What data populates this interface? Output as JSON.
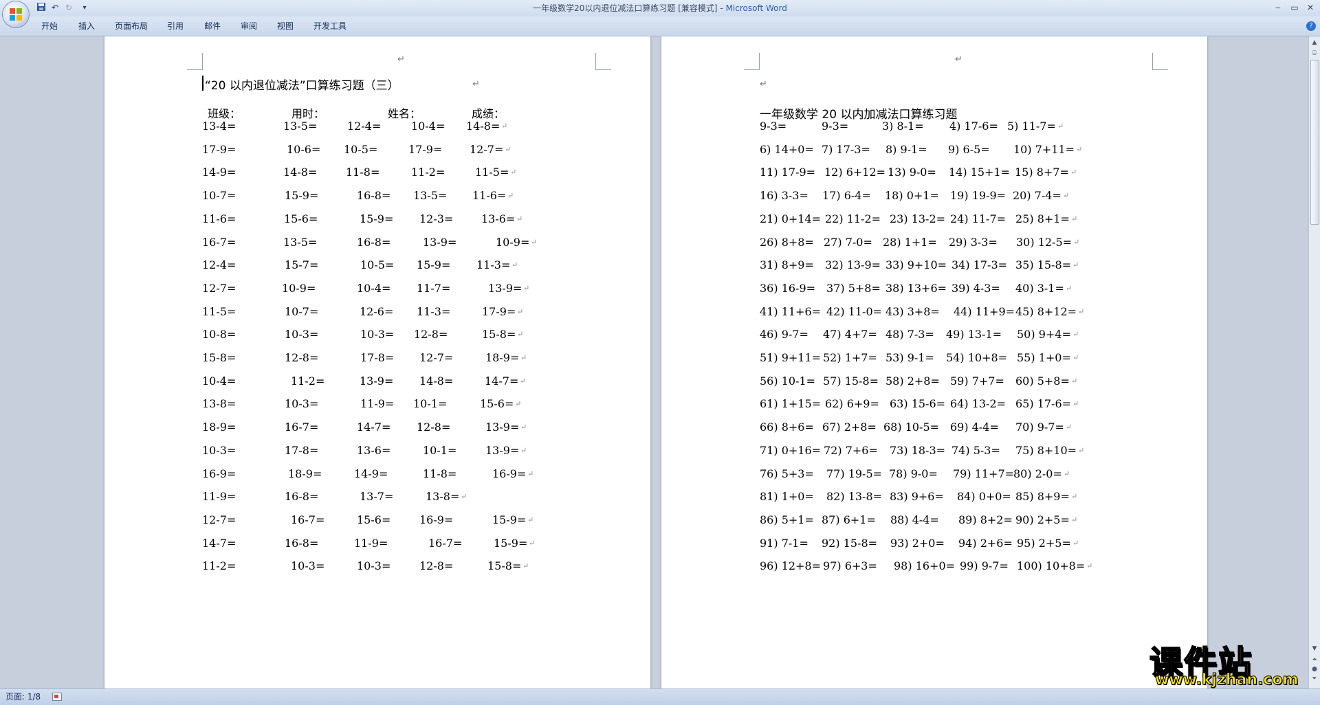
{
  "window": {
    "title": "一年级数学20以内退位减法口算练习题 [兼容模式] - ",
    "app_name": "Microsoft Word",
    "minimize_glyph": "‒",
    "maximize_glyph": "▭",
    "close_glyph": "✕"
  },
  "quick_access": {
    "save_icon": "save-icon",
    "undo_glyph": "↶",
    "redo_glyph": "↻",
    "customize_glyph": "▾"
  },
  "menu": [
    "开始",
    "插入",
    "页面布局",
    "引用",
    "邮件",
    "审阅",
    "视图",
    "开发工具"
  ],
  "help_glyph": "?",
  "pilcrow": "↵",
  "page_left": {
    "title": "“20 以内退位减法”口算练习题（三）",
    "header_labels": [
      "班级：",
      "用时：",
      "姓名：",
      "成绩："
    ],
    "rows": [
      [
        "13-4=",
        "13-5=",
        "12-4=",
        "10-4=",
        "14-8="
      ],
      [
        "17-9=",
        "10-6=",
        "10-5=",
        "17-9=",
        "12-7="
      ],
      [
        "14-9=",
        "14-8=",
        "11-8=",
        "11-2=",
        "11-5="
      ],
      [
        "10-7=",
        "15-9=",
        "16-8=",
        "13-5=",
        "11-6="
      ],
      [
        "11-6=",
        "15-6=",
        "15-9=",
        "12-3=",
        "13-6="
      ],
      [
        "16-7=",
        "13-5=",
        "16-8=",
        "13-9=",
        "10-9="
      ],
      [
        "12-4=",
        "15-7=",
        "10-5=",
        "15-9=",
        "11-3="
      ],
      [
        "12-7=",
        "10-9=",
        "10-4=",
        "11-7=",
        "13-9="
      ],
      [
        "11-5=",
        "10-7=",
        "12-6=",
        "11-3=",
        "17-9="
      ],
      [
        "10-8=",
        "10-3=",
        "10-3=",
        "12-8=",
        "15-8="
      ],
      [
        "15-8=",
        "12-8=",
        "17-8=",
        "12-7=",
        "18-9="
      ],
      [
        "10-4=",
        "11-2=",
        "13-9=",
        "14-8=",
        "14-7="
      ],
      [
        "13-8=",
        "10-3=",
        "11-9=",
        "10-1=",
        "15-6="
      ],
      [
        "18-9=",
        "16-7=",
        "14-7=",
        "12-8=",
        "13-9="
      ],
      [
        "10-3=",
        "17-8=",
        "13-6=",
        "10-1=",
        "13-9="
      ],
      [
        "16-9=",
        "18-9=",
        "14-9=",
        "11-8=",
        "16-9="
      ],
      [
        "11-9=",
        "16-8=",
        "13-7=",
        "13-8="
      ],
      [
        "12-7=",
        "16-7=",
        "15-6=",
        "16-9=",
        "15-9="
      ],
      [
        "14-7=",
        "16-8=",
        "11-9=",
        "16-7=",
        "15-9="
      ],
      [
        "11-2=",
        "10-3=",
        "10-3=",
        "12-8=",
        "15-8="
      ]
    ]
  },
  "page_right": {
    "title": "一年级数学 20 以内加减法口算练习题",
    "rows": [
      [
        "9-3=",
        "9-3=",
        "3) 8-1=",
        "4) 17-6=",
        "5) 11-7="
      ],
      [
        "6) 14+0=",
        "7) 17-3=",
        "8) 9-1=",
        "9) 6-5=",
        "10) 7+11="
      ],
      [
        "11) 17-9=",
        "12) 6+12=",
        "13) 9-0=",
        "14) 15+1=",
        "15) 8+7="
      ],
      [
        "16) 3-3=",
        "17) 6-4=",
        "18) 0+1=",
        "19) 19-9=",
        "20) 7-4="
      ],
      [
        "21) 0+14=",
        "22) 11-2=",
        "23) 13-2=",
        "24) 11-7=",
        "25) 8+1="
      ],
      [
        "26) 8+8=",
        "27) 7-0=",
        "28) 1+1=",
        "29) 3-3=",
        "30) 12-5="
      ],
      [
        "31) 8+9=",
        "32) 13-9=",
        "33) 9+10=",
        "34) 17-3=",
        "35) 15-8="
      ],
      [
        "36) 16-9=",
        "37) 5+8=",
        "38) 13+6=",
        "39) 4-3=",
        "40) 3-1="
      ],
      [
        "41) 11+6=",
        "42) 11-0=",
        "43) 3+8=",
        "44) 11+9=",
        "45) 8+12="
      ],
      [
        "46) 9-7=",
        "47) 4+7=",
        "48) 7-3=",
        "49) 13-1=",
        "50) 9+4="
      ],
      [
        "51) 9+11=",
        "52) 1+7=",
        "53) 9-1=",
        "54) 10+8=",
        "55) 1+0="
      ],
      [
        "56) 10-1=",
        "57) 15-8=",
        "58) 2+8=",
        "59) 7+7=",
        "60) 5+8="
      ],
      [
        "61) 1+15=",
        "62) 6+9=",
        "63) 15-6=",
        "64) 13-2=",
        "65) 17-6="
      ],
      [
        "66) 8+6=",
        "67) 2+8=",
        "68) 10-5=",
        "69) 4-4=",
        "70) 9-7="
      ],
      [
        "71) 0+16=",
        "72) 7+6=",
        "73) 18-3=",
        "74) 5-3=",
        "75) 8+10="
      ],
      [
        "76) 5+3=",
        "77) 19-5=",
        "78) 9-0=",
        "79) 11+7=",
        "80) 2-0="
      ],
      [
        "81) 1+0=",
        "82) 13-8=",
        "83) 9+6=",
        "84) 0+0=",
        "85) 8+9="
      ],
      [
        "86) 5+1=",
        "87) 6+1=",
        "88) 4-4=",
        "89) 8+2=",
        "90) 2+5="
      ],
      [
        "91) 7-1=",
        "92) 15-8=",
        "93) 2+0=",
        "94) 2+6=",
        "95) 2+5="
      ],
      [
        "96) 12+8=",
        "97) 6+3=",
        "98) 16+0=",
        "99) 9-7=",
        "100) 10+8="
      ]
    ]
  },
  "status": {
    "page_indicator": "页面: 1/8"
  },
  "watermark": {
    "main": "课件站",
    "url": "www.kjzhan.com"
  }
}
